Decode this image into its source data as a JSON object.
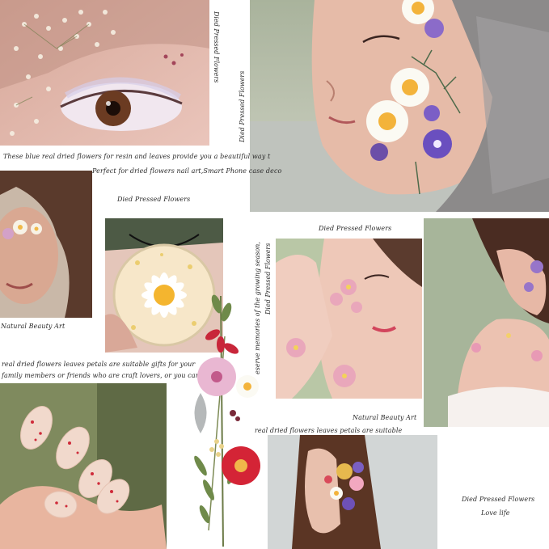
{
  "captions": {
    "top_vertical_1": "Died Pressed Flowers",
    "top_vertical_2": "Died Pressed Flowers",
    "line_1": "These blue real dried flowers for resin and leaves provide you a beautiful way t",
    "line_2": "Perfect for dried flowers nail art,Smart Phone case deco",
    "mid_label_1": "Died Pressed Flowers",
    "natural_beauty_1": "Natural Beauty Art",
    "mid_label_2": "Died Pressed Flowers",
    "vertical_long": "eserve memories of the growing season,",
    "vertical_short": "Died Pressed Flowers",
    "gift_line_1": "real dried flowers leaves petals are suitable gifts for your",
    "gift_line_2": "family members or friends who are craft lovers, or you can us",
    "natural_beauty_2": "Natural Beauty Art",
    "suitable_line": "real dried flowers leaves petals are suitable",
    "bottom_label": "Died Pressed Flowers",
    "love_life": "Love life"
  },
  "colors": {
    "background": "#ffffff",
    "caption_text": "#2a2a2a",
    "skin": "#e8b9a8",
    "petal_white": "#fbfaf3",
    "daisy_center": "#f3b33b",
    "purple": "#6a4fbf",
    "red_petal": "#c8263a"
  },
  "icons": {
    "eye_photo": "eye-with-flowers-photo",
    "face_photo": "face-with-daisies-photo",
    "pendant_photo": "resin-pendant-photo",
    "nails_photo": "dried-flower-nails-photo",
    "bouquet": "pressed-flower-bouquet"
  }
}
